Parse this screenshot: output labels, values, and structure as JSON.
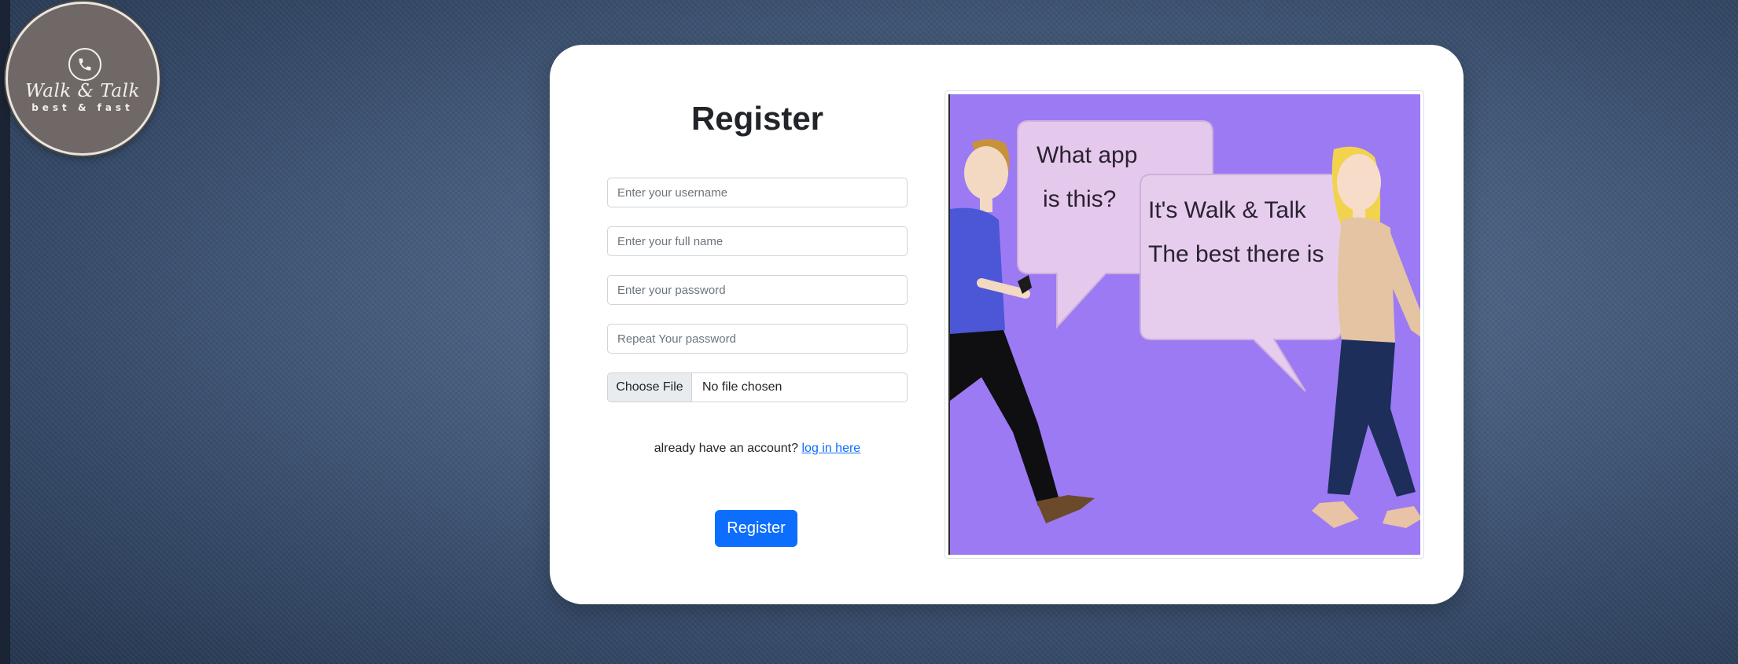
{
  "logo": {
    "title": "Walk & Talk",
    "tagline": "best & fast",
    "icon": "phone-icon"
  },
  "form": {
    "title": "Register",
    "username_placeholder": "Enter your username",
    "fullname_placeholder": "Enter your full name",
    "password_placeholder": "Enter your password",
    "repeat_password_placeholder": "Repeat Your password",
    "file_button_label": "Choose File",
    "file_status": "No file chosen",
    "login_prompt": "already have an account?",
    "login_link": "log in here",
    "submit_label": "Register"
  },
  "illustration": {
    "bubble_left_line1": "What app",
    "bubble_left_line2": "is this?",
    "bubble_right_line1": "It's Walk & Talk",
    "bubble_right_line2": "The best there is"
  },
  "colors": {
    "primary": "#0d6efd",
    "illustration_bg": "#9b7af3",
    "bubble": "#e4c9ec"
  }
}
